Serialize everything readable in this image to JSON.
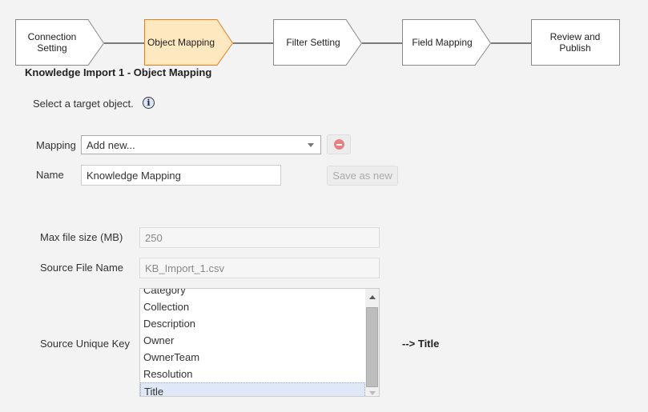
{
  "wizard": {
    "steps": [
      {
        "label": "Connection Setting",
        "state": "done"
      },
      {
        "label": "Object Mapping",
        "state": "active"
      },
      {
        "label": "Filter Setting",
        "state": "pending"
      },
      {
        "label": "Field Mapping",
        "state": "pending"
      },
      {
        "label": "Review and Publish",
        "state": "pending"
      }
    ],
    "active_fill": "#fde8c0",
    "active_border": "#f07c1a"
  },
  "page": {
    "title": "Knowledge Import 1 - Object Mapping",
    "instruction": "Select a target object.",
    "info_icon": "info-icon"
  },
  "form": {
    "mapping_label": "Mapping",
    "mapping_value": "Add new...",
    "name_label": "Name",
    "name_value": "Knowledge Mapping",
    "save_as_new": "Save as new",
    "max_size_label": "Max file size (MB)",
    "max_size_value": "250",
    "source_file_label": "Source File Name",
    "source_file_value": "KB_Import_1.csv",
    "unique_key_label": "Source Unique Key",
    "unique_key_options": [
      "Category",
      "Collection",
      "Description",
      "Owner",
      "OwnerTeam",
      "Resolution",
      "Title"
    ],
    "unique_key_selected": "Title",
    "target_text": "--> Title"
  }
}
